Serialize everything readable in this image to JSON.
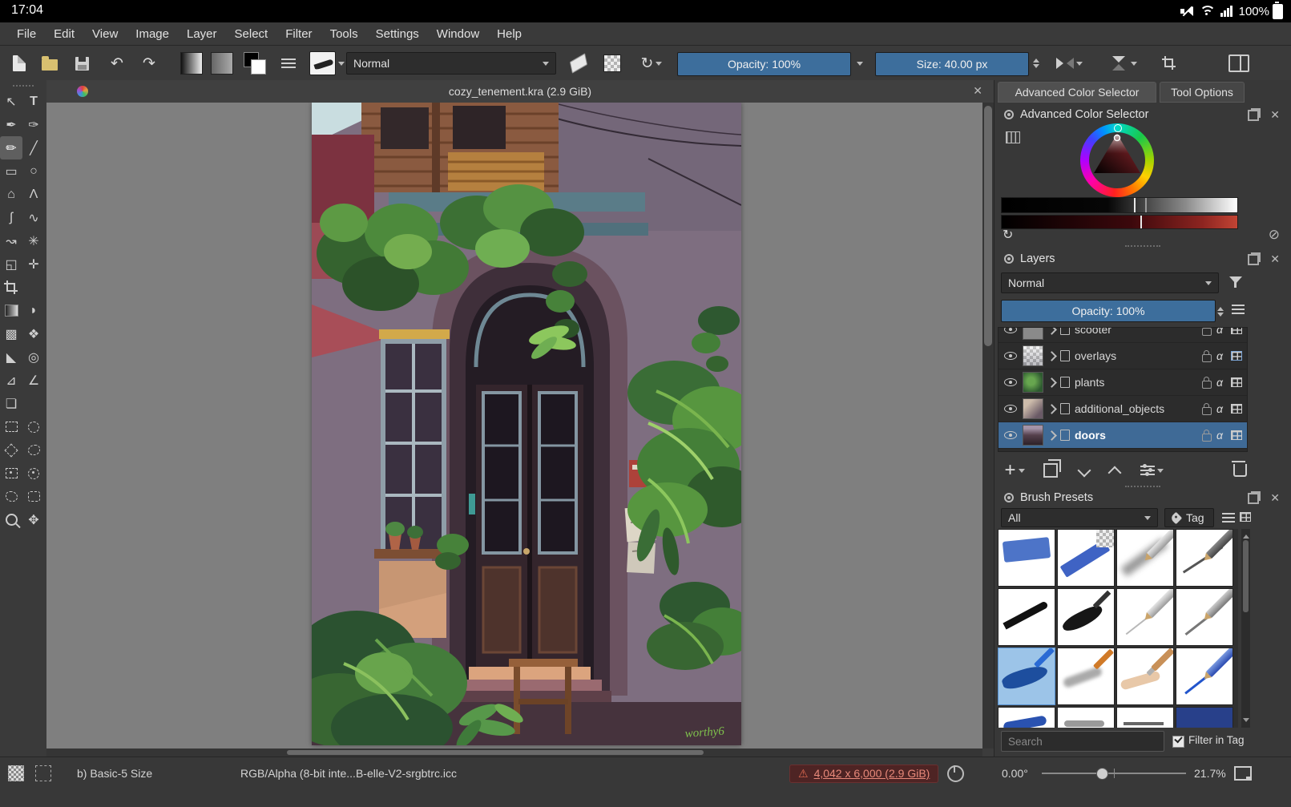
{
  "android": {
    "time": "17:04",
    "battery": "100%"
  },
  "menu": {
    "items": [
      "File",
      "Edit",
      "View",
      "Image",
      "Layer",
      "Select",
      "Filter",
      "Tools",
      "Settings",
      "Window",
      "Help"
    ]
  },
  "toolbar": {
    "blend_mode": "Normal",
    "opacity_label": "Opacity: 100%",
    "size_label": "Size: 40.00 px"
  },
  "document": {
    "tab_title": "cozy_tenement.kra (2.9 GiB)"
  },
  "artwork": {
    "signature": "worthy6"
  },
  "right_panel": {
    "tab_acs": "Advanced Color Selector",
    "tab_tool_options": "Tool Options",
    "acs_title": "Advanced Color Selector",
    "layers": {
      "title": "Layers",
      "blend_mode": "Normal",
      "opacity_label": "Opacity:  100%",
      "items": [
        {
          "name": "scooter"
        },
        {
          "name": "overlays"
        },
        {
          "name": "plants"
        },
        {
          "name": "additional_objects"
        },
        {
          "name": "doors"
        }
      ]
    },
    "presets": {
      "title": "Brush Presets",
      "filter_value": "All",
      "tag_label": "Tag",
      "search_placeholder": "Search",
      "filter_in_tag": "Filter in Tag"
    }
  },
  "status": {
    "brush_preset": "b) Basic-5 Size",
    "color_profile": "RGB/Alpha (8-bit inte...B-elle-V2-srgbtrc.icc",
    "dimensions": "4,042 x 6,000 (2.9 GiB)",
    "rotation": "0.00°",
    "zoom": "21.7%"
  },
  "icons": {
    "close": "✕",
    "warning": "⚠",
    "alpha": "α"
  },
  "colors": {
    "accent_blue": "#3d6e9c",
    "selected_layer": "#3f6a96",
    "warning_red": "#e8897a"
  }
}
